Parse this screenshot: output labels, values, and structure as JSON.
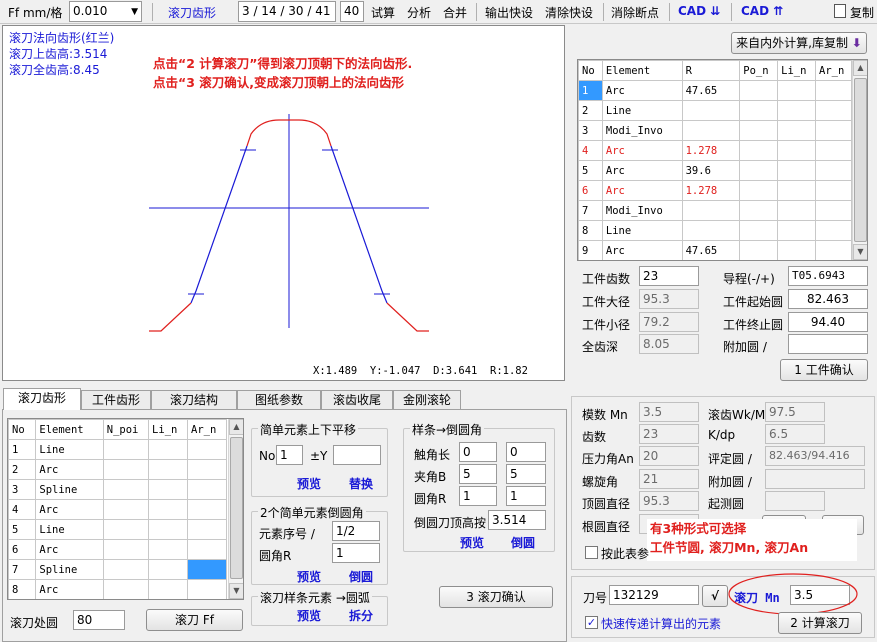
{
  "toolbar": {
    "ff_label": "Ff mm/格",
    "ff_value": "0.010",
    "hob_profile": "滚刀齿形",
    "ratio_value": "3 / 14 / 30 / 41",
    "count_value": "40",
    "trial": "试算",
    "analyze": "分析",
    "merge": "合并",
    "export_quick": "输出快设",
    "clear_quick": "清除快设",
    "clear_breakpoints": "消除断点",
    "cad_down": "CAD ⇊",
    "cad_up": "CAD ⇈",
    "copy": "复制"
  },
  "canvas": {
    "info1": "滚刀法向齿形(红兰)",
    "info2": "滚刀上齿高:3.514",
    "info3": "滚刀全齿高:8.45",
    "note1": "点击“2 计算滚刀”得到滚刀顶朝下的法向齿形.",
    "note2": "点击“3 滚刀确认,变成滚刀顶朝上的法向齿形",
    "status": "X:1.489  Y:-1.047  D:3.641  R:1.82"
  },
  "right_top": {
    "copy_button": "来自内外计算,库复制",
    "headers": [
      "No",
      "Element",
      "R",
      "Po_n",
      "Li_n",
      "Ar_n"
    ],
    "rows": [
      {
        "no": "1",
        "el": "Arc",
        "r": "47.65",
        "red": false
      },
      {
        "no": "2",
        "el": "Line",
        "r": "",
        "red": false
      },
      {
        "no": "3",
        "el": "Modi_Invo",
        "r": "",
        "red": false
      },
      {
        "no": "4",
        "el": "Arc",
        "r": "1.278",
        "red": true
      },
      {
        "no": "5",
        "el": "Arc",
        "r": "39.6",
        "red": false
      },
      {
        "no": "6",
        "el": "Arc",
        "r": "1.278",
        "red": true
      },
      {
        "no": "7",
        "el": "Modi_Invo",
        "r": "",
        "red": false
      },
      {
        "no": "8",
        "el": "Line",
        "r": "",
        "red": false
      },
      {
        "no": "9",
        "el": "Arc",
        "r": "47.65",
        "red": false
      }
    ],
    "teeth_label": "工件齿数",
    "teeth_value": "23",
    "lead_label": "导程(-/+)",
    "lead_value": "T05.6943",
    "od_label": "工件大径",
    "od_value": "95.3",
    "start_label": "工件起始圆",
    "start_value": "82.463",
    "id_label": "工件小径",
    "id_value": "79.2",
    "end_label": "工件终止圆",
    "end_value": "94.40",
    "depth_label": "全齿深",
    "depth_value": "8.05",
    "extra_label": "附加圆 /",
    "extra_value": "",
    "confirm_button": "1 工件确认"
  },
  "tabs": [
    "滚刀齿形",
    "工件齿形",
    "滚刀结构",
    "图纸参数",
    "滚齿收尾",
    "金刚滚轮"
  ],
  "hob_table": {
    "headers": [
      "No",
      "Element",
      "N_poi",
      "Li_n",
      "Ar_n"
    ],
    "rows": [
      {
        "no": "1",
        "el": "Line"
      },
      {
        "no": "2",
        "el": "Arc"
      },
      {
        "no": "3",
        "el": "Spline"
      },
      {
        "no": "4",
        "el": "Arc"
      },
      {
        "no": "5",
        "el": "Line"
      },
      {
        "no": "6",
        "el": "Arc"
      },
      {
        "no": "7",
        "el": "Spline"
      },
      {
        "no": "8",
        "el": "Arc"
      }
    ]
  },
  "hob_circle_label": "滚刀处圆",
  "hob_circle_value": "80",
  "hob_ff_button": "滚刀 Ff",
  "shift": {
    "title": "简单元素上下平移",
    "no_label": "No",
    "no_value": "1",
    "y_label": "±Y",
    "y_value": "",
    "preview": "预览",
    "replace": "替换"
  },
  "fillet": {
    "title": "2个简单元素倒圆角",
    "seq_label": "元素序号 /",
    "seq_value": "1/2",
    "r_label": "圆角R",
    "r_value": "1",
    "preview": "预览",
    "apply": "倒圆"
  },
  "spline_arc": {
    "title": "滚刀样条元素 →圆弧",
    "preview": "预览",
    "split": "拆分"
  },
  "spline_round": {
    "title": "样条→倒圆角",
    "touch_label": "触角长",
    "touch_a": "0",
    "touch_b": "0",
    "angle_label": "夹角B",
    "angle_a": "5",
    "angle_b": "5",
    "cr_label": "圆角R",
    "cr_a": "1",
    "cr_b": "1",
    "height_label": "倒圆刀顶高按",
    "height_value": "3.514",
    "preview": "预览",
    "apply": "倒圆"
  },
  "confirm3": "3 滚刀确认",
  "params": {
    "module_label": "模数 Mn",
    "module_value": "3.5",
    "hob_wk_label": "滚齿Wk/M",
    "hob_wk_value": "97.5",
    "teeth_label": "齿数",
    "teeth_value": "23",
    "kdp_label": "K/dp",
    "kdp_value": "6.5",
    "pa_label": "压力角An",
    "pa_value": "20",
    "eval_label": "评定圆 /",
    "eval_value": "82.463/94.416",
    "helix_label": "螺旋角",
    "helix_value": "21",
    "extra_label": "附加圆 /",
    "extra_value": "",
    "tip_label": "顶圆直径",
    "tip_value": "95.3",
    "start_label": "起测圆",
    "start_value": "",
    "root_label": "根圆直径",
    "root_value": "",
    "overlay1": "有3种形式可选择",
    "overlay2": "工件节圆, 滚刀Mn, 滚刀An",
    "by_table": "按此表参"
  },
  "bottom": {
    "tool_no_label": "刀号",
    "tool_no_value": "132129",
    "check_btn": "√",
    "hob_mn_label": "滚刀 Mn",
    "hob_mn_value": "3.5",
    "fast_pass": "快速传递计算出的元素",
    "calc_button": "2 计算滚刀"
  }
}
